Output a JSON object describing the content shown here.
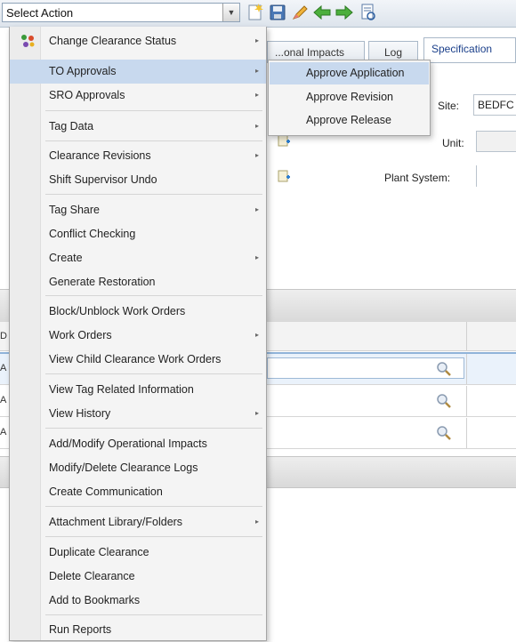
{
  "toolbar": {
    "select_action": {
      "value": "Select Action"
    },
    "icons": [
      "dropdown-arrow-icon",
      "new-icon",
      "save-icon",
      "edit-icon",
      "back-icon",
      "forward-icon",
      "print-preview-icon"
    ]
  },
  "tabs": [
    {
      "label": "...onal Impacts"
    },
    {
      "label": "Log"
    },
    {
      "label": "Specification"
    }
  ],
  "form": {
    "site_label": "Site:",
    "site_value": "BEDFC",
    "unit_label": "Unit:",
    "unit_value": "",
    "plant_system_label": "Plant System:",
    "plant_system_value": ""
  },
  "left_fragments": [
    "D",
    "A",
    "A",
    "A"
  ],
  "menu": {
    "items": [
      {
        "label": "Change Clearance Status",
        "submenu": true,
        "icon": "status-icon"
      },
      {
        "label": "TO Approvals",
        "submenu": true,
        "highlighted": true
      },
      {
        "label": "SRO Approvals",
        "submenu": true
      },
      {
        "label": "Tag Data",
        "submenu": true
      },
      {
        "label": "Clearance Revisions",
        "submenu": true
      },
      {
        "label": "Shift Supervisor Undo",
        "submenu": false
      },
      {
        "label": "Tag Share",
        "submenu": true
      },
      {
        "label": "Conflict Checking",
        "submenu": false
      },
      {
        "label": "Create",
        "submenu": true
      },
      {
        "label": "Generate Restoration",
        "submenu": false
      },
      {
        "label": "Block/Unblock Work Orders",
        "submenu": false
      },
      {
        "label": "Work Orders",
        "submenu": true
      },
      {
        "label": "View Child Clearance Work Orders",
        "submenu": false
      },
      {
        "label": "View Tag Related Information",
        "submenu": false
      },
      {
        "label": "View History",
        "submenu": true
      },
      {
        "label": "Add/Modify Operational Impacts",
        "submenu": false
      },
      {
        "label": "Modify/Delete Clearance Logs",
        "submenu": false
      },
      {
        "label": "Create Communication",
        "submenu": false
      },
      {
        "label": "Attachment Library/Folders",
        "submenu": true
      },
      {
        "label": "Duplicate Clearance",
        "submenu": false
      },
      {
        "label": "Delete Clearance",
        "submenu": false
      },
      {
        "label": "Add to Bookmarks",
        "submenu": false
      },
      {
        "label": "Run Reports",
        "submenu": false
      }
    ]
  },
  "submenu": {
    "items": [
      {
        "label": "Approve Application",
        "highlighted": true
      },
      {
        "label": "Approve Revision"
      },
      {
        "label": "Approve Release"
      }
    ]
  },
  "colors": {
    "highlight": "#c8d9ee",
    "menu_bg": "#f4f4f4",
    "toolbar_top": "#f2f5f9",
    "link_blue": "#1a3f8a"
  }
}
